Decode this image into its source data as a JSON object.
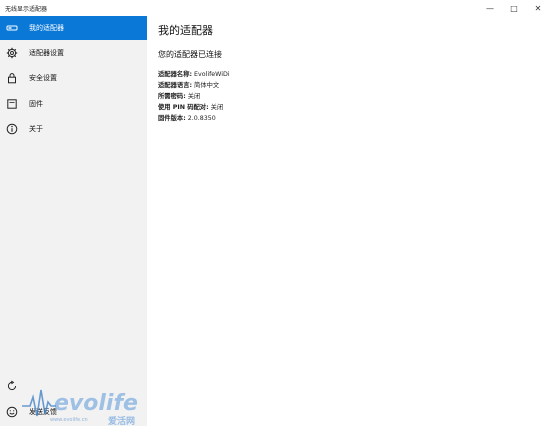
{
  "window": {
    "title": "无线显示适配器",
    "controls": {
      "minimize": "—",
      "maximize": "□",
      "close": "✕"
    }
  },
  "sidebar": {
    "items": [
      {
        "label": "我的适配器",
        "icon": "adapter-icon",
        "active": true
      },
      {
        "label": "适配器设置",
        "icon": "gear-icon",
        "active": false
      },
      {
        "label": "安全设置",
        "icon": "lock-icon",
        "active": false
      },
      {
        "label": "固件",
        "icon": "firmware-icon",
        "active": false
      },
      {
        "label": "关于",
        "icon": "info-icon",
        "active": false
      }
    ],
    "bottom": [
      {
        "label": "",
        "icon": "refresh-icon"
      },
      {
        "label": "发送反馈",
        "icon": "smiley-icon"
      }
    ],
    "accent": "#0a78d7"
  },
  "main": {
    "title": "我的适配器",
    "status": "您的适配器已连接",
    "properties": [
      {
        "key": "适配器名称:",
        "value": "EvolifeWiDi"
      },
      {
        "key": "适配器语言:",
        "value": "简体中文"
      },
      {
        "key": "所需密码:",
        "value": "关闭"
      },
      {
        "key": "使用 PIN 码配对:",
        "value": "关闭"
      },
      {
        "key": "固件版本:",
        "value": "2.0.8350"
      }
    ]
  },
  "watermark": {
    "brand": "evolife",
    "sub": "www.evolife.cn",
    "cn": "爱活网"
  }
}
